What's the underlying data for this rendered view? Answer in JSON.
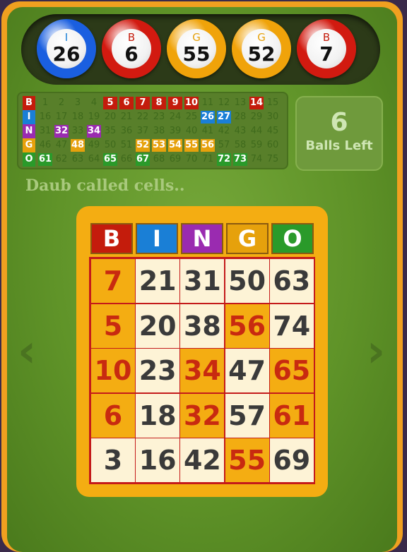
{
  "colors": {
    "B": "#c41c0c",
    "I": "#1a7fd6",
    "N": "#9a2bb0",
    "G": "#e6a10c",
    "O": "#2a9a2a"
  },
  "balls": [
    {
      "letter": "I",
      "number": "26",
      "ring": "#1a5fe0"
    },
    {
      "letter": "B",
      "number": "6",
      "ring": "#d21a10"
    },
    {
      "letter": "G",
      "number": "55",
      "ring": "#f0a30a"
    },
    {
      "letter": "G",
      "number": "52",
      "ring": "#f0a30a"
    },
    {
      "letter": "B",
      "number": "7",
      "ring": "#d21a10"
    }
  ],
  "called_grid": {
    "rows": [
      {
        "letter": "B",
        "numbers": [
          "1",
          "2",
          "3",
          "4",
          "5",
          "6",
          "7",
          "8",
          "9",
          "10",
          "11",
          "12",
          "13",
          "14",
          "15"
        ],
        "called": [
          "5",
          "6",
          "7",
          "8",
          "9",
          "10",
          "14"
        ]
      },
      {
        "letter": "I",
        "numbers": [
          "16",
          "17",
          "18",
          "19",
          "20",
          "21",
          "22",
          "23",
          "24",
          "25",
          "26",
          "27",
          "28",
          "29",
          "30"
        ],
        "called": [
          "26",
          "27"
        ]
      },
      {
        "letter": "N",
        "numbers": [
          "31",
          "32",
          "33",
          "34",
          "35",
          "36",
          "37",
          "38",
          "39",
          "40",
          "41",
          "42",
          "43",
          "44",
          "45"
        ],
        "called": [
          "32",
          "34"
        ]
      },
      {
        "letter": "G",
        "numbers": [
          "46",
          "47",
          "48",
          "49",
          "50",
          "51",
          "52",
          "53",
          "54",
          "55",
          "56",
          "57",
          "58",
          "59",
          "60"
        ],
        "called": [
          "48",
          "52",
          "53",
          "54",
          "55",
          "56"
        ]
      },
      {
        "letter": "O",
        "numbers": [
          "61",
          "62",
          "63",
          "64",
          "65",
          "66",
          "67",
          "68",
          "69",
          "70",
          "71",
          "72",
          "73",
          "74",
          "75"
        ],
        "called": [
          "61",
          "65",
          "67",
          "72",
          "73"
        ]
      }
    ]
  },
  "balls_left": {
    "count": "6",
    "label": "Balls Left"
  },
  "status": "Daub called cells..",
  "nav": {
    "prev": "‹",
    "next": "›"
  },
  "card": {
    "headers": [
      "B",
      "I",
      "N",
      "G",
      "O"
    ],
    "rows": [
      [
        {
          "n": "7",
          "d": true
        },
        {
          "n": "21",
          "d": false
        },
        {
          "n": "31",
          "d": false
        },
        {
          "n": "50",
          "d": false
        },
        {
          "n": "63",
          "d": false
        }
      ],
      [
        {
          "n": "5",
          "d": true
        },
        {
          "n": "20",
          "d": false
        },
        {
          "n": "38",
          "d": false
        },
        {
          "n": "56",
          "d": true
        },
        {
          "n": "74",
          "d": false
        }
      ],
      [
        {
          "n": "10",
          "d": true
        },
        {
          "n": "23",
          "d": false
        },
        {
          "n": "34",
          "d": true
        },
        {
          "n": "47",
          "d": false
        },
        {
          "n": "65",
          "d": true
        }
      ],
      [
        {
          "n": "6",
          "d": true
        },
        {
          "n": "18",
          "d": false
        },
        {
          "n": "32",
          "d": true
        },
        {
          "n": "57",
          "d": false
        },
        {
          "n": "61",
          "d": true
        }
      ],
      [
        {
          "n": "3",
          "d": false
        },
        {
          "n": "16",
          "d": false
        },
        {
          "n": "42",
          "d": false
        },
        {
          "n": "55",
          "d": true
        },
        {
          "n": "69",
          "d": false
        }
      ]
    ]
  }
}
